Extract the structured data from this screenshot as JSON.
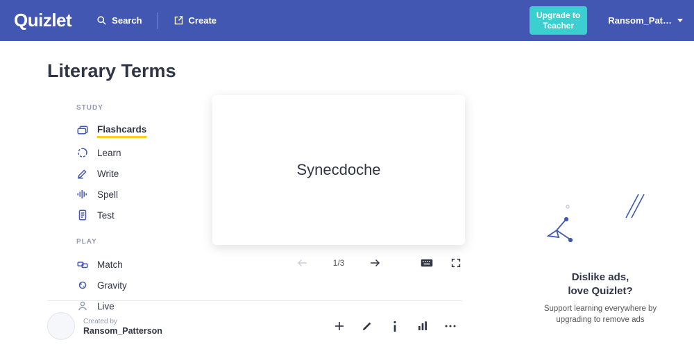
{
  "header": {
    "logo": "Quizlet",
    "search_label": "Search",
    "create_label": "Create",
    "upgrade_line1": "Upgrade to",
    "upgrade_line2": "Teacher",
    "username": "Ransom_Pat…"
  },
  "page": {
    "title": "Literary Terms"
  },
  "side": {
    "study_heading": "STUDY",
    "play_heading": "PLAY",
    "flashcards": "Flashcards",
    "learn": "Learn",
    "write": "Write",
    "spell": "Spell",
    "test": "Test",
    "match": "Match",
    "gravity": "Gravity",
    "live": "Live"
  },
  "flashcard": {
    "term": "Synecdoche",
    "current": 1,
    "total": 3,
    "counter": "1/3"
  },
  "meta": {
    "created_by_label": "Created by",
    "creator": "Ransom_Patterson"
  },
  "promo": {
    "title_line1": "Dislike ads,",
    "title_line2": "love Quizlet?",
    "body": "Support learning everywhere by upgrading to remove ads"
  }
}
